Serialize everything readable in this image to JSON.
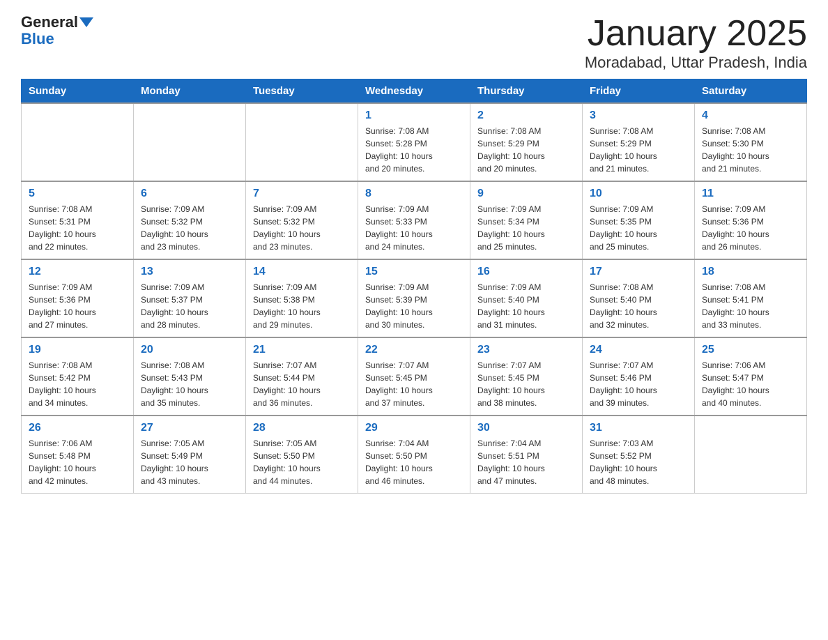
{
  "header": {
    "logo_line1": "General",
    "logo_line2": "Blue",
    "month_title": "January 2025",
    "location": "Moradabad, Uttar Pradesh, India"
  },
  "days_of_week": [
    "Sunday",
    "Monday",
    "Tuesday",
    "Wednesday",
    "Thursday",
    "Friday",
    "Saturday"
  ],
  "weeks": [
    {
      "days": [
        {
          "number": "",
          "info": ""
        },
        {
          "number": "",
          "info": ""
        },
        {
          "number": "",
          "info": ""
        },
        {
          "number": "1",
          "info": "Sunrise: 7:08 AM\nSunset: 5:28 PM\nDaylight: 10 hours\nand 20 minutes."
        },
        {
          "number": "2",
          "info": "Sunrise: 7:08 AM\nSunset: 5:29 PM\nDaylight: 10 hours\nand 20 minutes."
        },
        {
          "number": "3",
          "info": "Sunrise: 7:08 AM\nSunset: 5:29 PM\nDaylight: 10 hours\nand 21 minutes."
        },
        {
          "number": "4",
          "info": "Sunrise: 7:08 AM\nSunset: 5:30 PM\nDaylight: 10 hours\nand 21 minutes."
        }
      ]
    },
    {
      "days": [
        {
          "number": "5",
          "info": "Sunrise: 7:08 AM\nSunset: 5:31 PM\nDaylight: 10 hours\nand 22 minutes."
        },
        {
          "number": "6",
          "info": "Sunrise: 7:09 AM\nSunset: 5:32 PM\nDaylight: 10 hours\nand 23 minutes."
        },
        {
          "number": "7",
          "info": "Sunrise: 7:09 AM\nSunset: 5:32 PM\nDaylight: 10 hours\nand 23 minutes."
        },
        {
          "number": "8",
          "info": "Sunrise: 7:09 AM\nSunset: 5:33 PM\nDaylight: 10 hours\nand 24 minutes."
        },
        {
          "number": "9",
          "info": "Sunrise: 7:09 AM\nSunset: 5:34 PM\nDaylight: 10 hours\nand 25 minutes."
        },
        {
          "number": "10",
          "info": "Sunrise: 7:09 AM\nSunset: 5:35 PM\nDaylight: 10 hours\nand 25 minutes."
        },
        {
          "number": "11",
          "info": "Sunrise: 7:09 AM\nSunset: 5:36 PM\nDaylight: 10 hours\nand 26 minutes."
        }
      ]
    },
    {
      "days": [
        {
          "number": "12",
          "info": "Sunrise: 7:09 AM\nSunset: 5:36 PM\nDaylight: 10 hours\nand 27 minutes."
        },
        {
          "number": "13",
          "info": "Sunrise: 7:09 AM\nSunset: 5:37 PM\nDaylight: 10 hours\nand 28 minutes."
        },
        {
          "number": "14",
          "info": "Sunrise: 7:09 AM\nSunset: 5:38 PM\nDaylight: 10 hours\nand 29 minutes."
        },
        {
          "number": "15",
          "info": "Sunrise: 7:09 AM\nSunset: 5:39 PM\nDaylight: 10 hours\nand 30 minutes."
        },
        {
          "number": "16",
          "info": "Sunrise: 7:09 AM\nSunset: 5:40 PM\nDaylight: 10 hours\nand 31 minutes."
        },
        {
          "number": "17",
          "info": "Sunrise: 7:08 AM\nSunset: 5:40 PM\nDaylight: 10 hours\nand 32 minutes."
        },
        {
          "number": "18",
          "info": "Sunrise: 7:08 AM\nSunset: 5:41 PM\nDaylight: 10 hours\nand 33 minutes."
        }
      ]
    },
    {
      "days": [
        {
          "number": "19",
          "info": "Sunrise: 7:08 AM\nSunset: 5:42 PM\nDaylight: 10 hours\nand 34 minutes."
        },
        {
          "number": "20",
          "info": "Sunrise: 7:08 AM\nSunset: 5:43 PM\nDaylight: 10 hours\nand 35 minutes."
        },
        {
          "number": "21",
          "info": "Sunrise: 7:07 AM\nSunset: 5:44 PM\nDaylight: 10 hours\nand 36 minutes."
        },
        {
          "number": "22",
          "info": "Sunrise: 7:07 AM\nSunset: 5:45 PM\nDaylight: 10 hours\nand 37 minutes."
        },
        {
          "number": "23",
          "info": "Sunrise: 7:07 AM\nSunset: 5:45 PM\nDaylight: 10 hours\nand 38 minutes."
        },
        {
          "number": "24",
          "info": "Sunrise: 7:07 AM\nSunset: 5:46 PM\nDaylight: 10 hours\nand 39 minutes."
        },
        {
          "number": "25",
          "info": "Sunrise: 7:06 AM\nSunset: 5:47 PM\nDaylight: 10 hours\nand 40 minutes."
        }
      ]
    },
    {
      "days": [
        {
          "number": "26",
          "info": "Sunrise: 7:06 AM\nSunset: 5:48 PM\nDaylight: 10 hours\nand 42 minutes."
        },
        {
          "number": "27",
          "info": "Sunrise: 7:05 AM\nSunset: 5:49 PM\nDaylight: 10 hours\nand 43 minutes."
        },
        {
          "number": "28",
          "info": "Sunrise: 7:05 AM\nSunset: 5:50 PM\nDaylight: 10 hours\nand 44 minutes."
        },
        {
          "number": "29",
          "info": "Sunrise: 7:04 AM\nSunset: 5:50 PM\nDaylight: 10 hours\nand 46 minutes."
        },
        {
          "number": "30",
          "info": "Sunrise: 7:04 AM\nSunset: 5:51 PM\nDaylight: 10 hours\nand 47 minutes."
        },
        {
          "number": "31",
          "info": "Sunrise: 7:03 AM\nSunset: 5:52 PM\nDaylight: 10 hours\nand 48 minutes."
        },
        {
          "number": "",
          "info": ""
        }
      ]
    }
  ]
}
